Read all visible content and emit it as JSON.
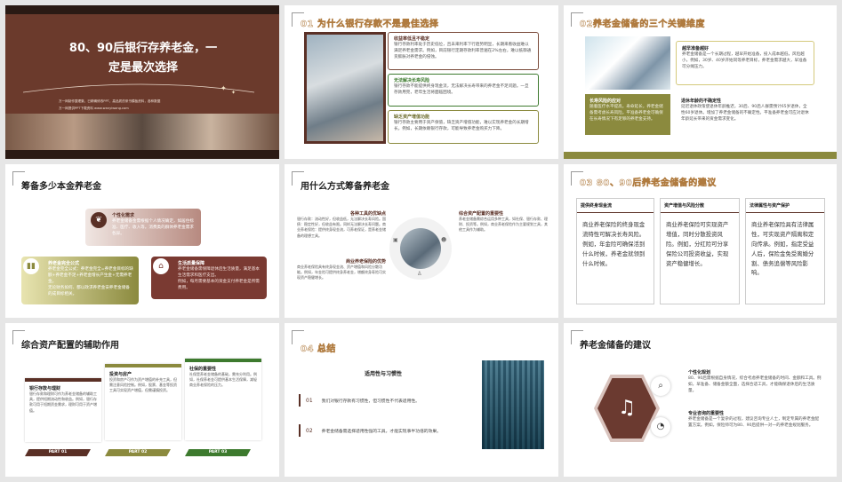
{
  "s1": {
    "title_line1": "80、90后银行存养老金，一",
    "title_line2": "定是最次选择",
    "sub1": "万一网制作整理集，已精确修改PPT，高品质的采书模板资料，各种数据",
    "sub2": "万一网提供PPT下载资料",
    "url": "www.wanyiwang.com"
  },
  "s2": {
    "title": "01 为什么银行存款不是最佳选择",
    "b1_title": "收益率低且不稳定",
    "b1_text": "银行存款利率处于历史低位，且未来利率下行趋势明显，长期来看收益难以满足养老金需求。例如，目前银行定期存款利率普遍在2%左右，难以抵御通货膨胀对养老金的侵蚀。",
    "b2_title": "无法解决长寿风险",
    "b2_text": "银行存款不能提供终身现金流，无法解决长寿带来的养老金不足问题。一旦存款用完，老年生活将面临困境。",
    "b3_title": "缺乏资产增值功能",
    "b3_text": "银行存款主要用于资产保值，缺乏资产增值功能，难以实现养老金的长期增长。例如，长期依赖银行存款，可能导致养老金购买力下降。"
  },
  "s3": {
    "title": "02养老金储备的三个关键维度",
    "c1_title": "越早准备越好",
    "c1_text": "养老金储备是一个长期过程，越早开始准备，投入成本越低，风险越小。例如，30岁、40岁开始同等养老目标，养老金需求越大，早准备可分摊压力。",
    "c2_title": "长寿风险的应对",
    "c2_text": "随着医疗水平提高，寿命延长，养老金储备需考虑长寿风险。平准备养老金可确保在长寿情况下有足够的养老金支持。",
    "c3_title": "退休年龄的不确定性",
    "c3_text": "延迟退休政策使退休年龄推迟，30后、90后人群需预计65岁退休，全性60岁退休。增加了养老金储备的不确定性。平准备养老金可应对退休年龄延长带来的资金需求变化。"
  },
  "s4": {
    "title": "筹备多少本金养老金",
    "c1_title": "个性化需求",
    "c1_text": "养老金储备金需根据个人情况确定，如居住标准、医疗、收入等。消费类的群体养老金需求各异。",
    "c2_title": "养老金完全公式",
    "c2_text": "养老金完全公式：养老金完全=养老金目标的缺额+养老金不足+养老金增长产生金+无需养老金。",
    "c2_text2": "无论财务如何、都以政求养老金安养老金储备的成目标相关。",
    "c3_title": "生活质量保障",
    "c3_text": "养老金储备需保障退休后生活质量，满足基本生活需求和医疗支出。",
    "c3_text2": "例如，每月需要基本的资金支付养老金是所需费用。"
  },
  "s5": {
    "title": "用什么方式筹备养老金",
    "tl_title": "各种工具的优缺点",
    "tl_text": "银行存款：流动性好，但收益低，无法解决长寿风险。国债：稳定性好，但收益有限。同样无法解决长寿问题。商业养老保险：提供终身现金流，可养老保证，是养老金储备的理想工具。",
    "bl_title": "商业养老保险的优势",
    "bl_text": "商业养老保险具有终身现金流、资产增值和风险分散功能。例如，年金险可提供终身养老金，增额终身寿险可实现资产稳健增长。",
    "tr_title": "综合资产配置的重要性",
    "tr_text": "养老金储备需综合运用多种工具，如社保、银行存款、理财、投资等。例如，商业养老保险作为主要规划工具，其他工具作为辅助。"
  },
  "s6": {
    "title": "03 80、90后养老金储备的建议",
    "c1_title": "提供终身现金流",
    "c1_text": "商业养老保险的终身现金流特性可解决长寿风险。例如，年金险可确保活到什么时候，养老金就领到什么时候。",
    "c2_title": "资产增值与风险分散",
    "c2_text": "商业养老保险可实现资产增值，同时分散投资风险。例如，分红险可分享保险公司投资收益，实现资产稳健增长。",
    "c3_title": "法律属性与资产保护",
    "c3_text": "商业养老保险具有法律属性，可实现资产隔离和定向传承。例如，指定受益人后，保险金免受离婚分割、债务追偿等风险影响。"
  },
  "s7": {
    "title": "综合资产配置的辅助作用",
    "c1_title": "银行存款与理财",
    "c1_text": "银行存款和理财可作为养老金储备的辅助工具，提供短期流动性和收益。例如，银行存款可用于短期资金需求，理财可用于资产增值。",
    "c2_title": "投资与房产",
    "c2_text": "投资和房产可作为资产增值的补充工具，但需注意风险控制。例如，股票、基金等投资工具可实现资产增值，但需谨慎投资。",
    "c3_title": "社保的重要性",
    "c3_text": "社保是养老金储备的基础，需充分利用。例如，社保养老金可提供基本生活保障，减轻商业养老保险的压力。",
    "p1": "PART 01",
    "p2": "PART 02",
    "p3": "PART 03"
  },
  "s8": {
    "title": "04 总结",
    "sub": "适用性与习惯性",
    "n1": "01",
    "t1": "我们对银行存款有习惯性，但习惯性不代表适用性。",
    "n2": "02",
    "t2": "养老金储备需选择适用性强的工具，才能实现事半功倍的效果。"
  },
  "s9": {
    "title": "养老金储备的建议",
    "c1_title": "个性化规划",
    "c1_text": "80、90后需根据自身情况，综合考虑养老金储备的时间、金额和工具。例如，早准备、储备金额全面，选择合适工具，才能确保退休后的生活质量。",
    "c2_title": "专业咨询的重要性",
    "c2_text": "养老金储备是一个复杂的过程，建议咨询专业人士，制定专属的养老金配置方案。例如，保险师可为80、90后提供一对一的养老金规划服务。"
  },
  "colors": {
    "brown": "#5a3026",
    "olive": "#8b8a3e",
    "green": "#3d7a2e",
    "gold": "#b07b3f"
  }
}
